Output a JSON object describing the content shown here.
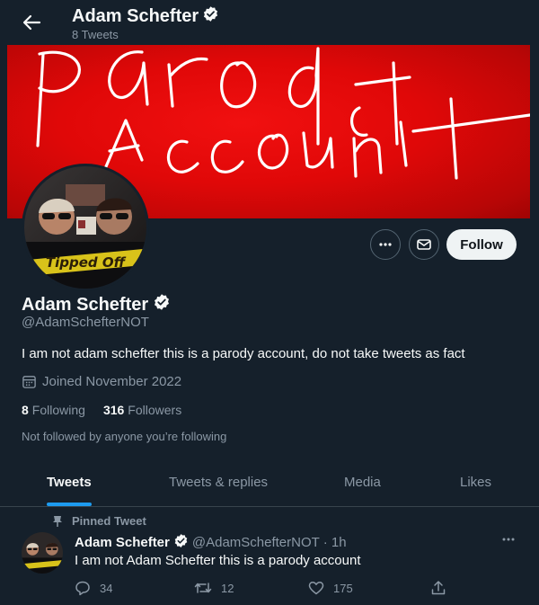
{
  "header": {
    "name": "Adam Schefter",
    "tweet_count": "8 Tweets"
  },
  "banner": {
    "handwriting": "parody account"
  },
  "profile": {
    "name": "Adam Schefter",
    "handle": "@AdamSchefterNOT",
    "bio": "I am not adam schefter this is a parody account, do not take tweets as fact",
    "joined": "Joined November 2022",
    "following_count": "8",
    "following_label": "Following",
    "followers_count": "316",
    "followers_label": "Followers",
    "not_followed": "Not followed by anyone you’re following",
    "avatar_caption": "Tipped Off"
  },
  "actions": {
    "follow_label": "Follow"
  },
  "tabs": [
    {
      "label": "Tweets"
    },
    {
      "label": "Tweets & replies"
    },
    {
      "label": "Media"
    },
    {
      "label": "Likes"
    }
  ],
  "tweet": {
    "pinned_label": "Pinned Tweet",
    "name": "Adam Schefter",
    "handle_time": "@AdamSchefterNOT · 1h",
    "text": "I am not Adam Schefter this is a parody account",
    "replies": "34",
    "retweets": "12",
    "likes": "175"
  },
  "colors": {
    "background": "#15202b",
    "accent": "#1d9bf0",
    "banner": "#e00808",
    "muted": "#8b98a5"
  },
  "icons": [
    "back-arrow-icon",
    "verified-badge-icon",
    "more-icon",
    "message-icon",
    "calendar-icon",
    "pin-icon",
    "reply-icon",
    "retweet-icon",
    "like-icon",
    "share-icon"
  ]
}
